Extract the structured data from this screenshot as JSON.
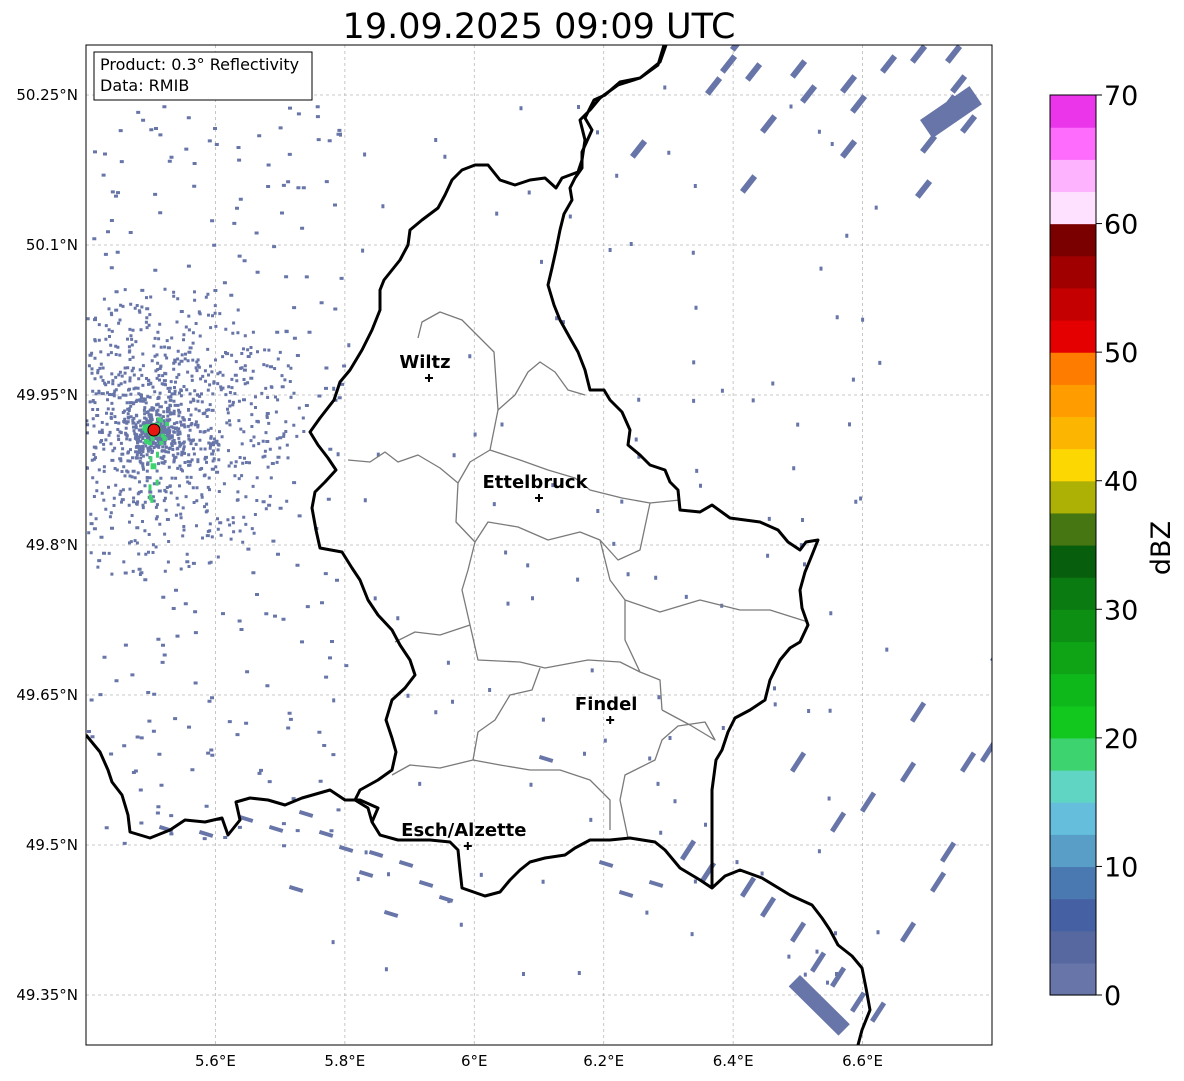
{
  "title": "19.09.2025 09:09 UTC",
  "info_box": {
    "product": "Product: 0.3° Reflectivity",
    "data": "Data: RMIB"
  },
  "map": {
    "lon_range": [
      5.4,
      6.8
    ],
    "lat_range": [
      49.3,
      50.3
    ],
    "lon_ticks": [
      {
        "value": 5.6,
        "label": "5.6°E"
      },
      {
        "value": 5.8,
        "label": "5.8°E"
      },
      {
        "value": 6.0,
        "label": "6°E"
      },
      {
        "value": 6.2,
        "label": "6.2°E"
      },
      {
        "value": 6.4,
        "label": "6.4°E"
      },
      {
        "value": 6.6,
        "label": "6.6°E"
      }
    ],
    "lat_ticks": [
      {
        "value": 50.25,
        "label": "50.25°N"
      },
      {
        "value": 50.1,
        "label": "50.1°N"
      },
      {
        "value": 49.95,
        "label": "49.95°N"
      },
      {
        "value": 49.8,
        "label": "49.8°N"
      },
      {
        "value": 49.65,
        "label": "49.65°N"
      },
      {
        "value": 49.5,
        "label": "49.5°N"
      },
      {
        "value": 49.35,
        "label": "49.35°N"
      }
    ],
    "cities": [
      {
        "name": "Wiltz",
        "lon": 5.93,
        "lat": 49.967
      },
      {
        "name": "Ettelbruck",
        "lon": 6.1,
        "lat": 49.847
      },
      {
        "name": "Findel",
        "lon": 6.21,
        "lat": 49.625
      },
      {
        "name": "Esch/Alzette",
        "lon": 5.99,
        "lat": 49.499
      }
    ],
    "radar_site": {
      "lon": 5.505,
      "lat": 49.915,
      "color": "#e8170f"
    }
  },
  "colorbar": {
    "label": "dBZ",
    "min": 0,
    "max": 70,
    "ticks": [
      0,
      10,
      20,
      30,
      40,
      50,
      60,
      70
    ],
    "colors": [
      "#6775a8",
      "#56689f",
      "#4560a3",
      "#4a79b2",
      "#589ec7",
      "#64bedc",
      "#61d5c3",
      "#3dd46f",
      "#12c71d",
      "#0fb81a",
      "#0ea416",
      "#0c8f13",
      "#0a7b10",
      "#075e0c",
      "#457611",
      "#adb005",
      "#fdd702",
      "#fcb501",
      "#fe9c00",
      "#fe7c00",
      "#e40000",
      "#c40000",
      "#a10000",
      "#7a0000",
      "#fee1fe",
      "#feb3fe",
      "#fe6cfe",
      "#ea35ea"
    ]
  }
}
